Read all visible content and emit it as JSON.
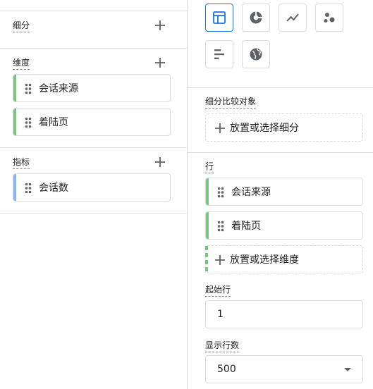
{
  "left": {
    "segments": {
      "label": "细分"
    },
    "dimensions": {
      "label": "维度",
      "items": [
        {
          "label": "会话来源"
        },
        {
          "label": "着陆页"
        }
      ]
    },
    "metrics": {
      "label": "指标",
      "items": [
        {
          "label": "会话数"
        }
      ]
    }
  },
  "right": {
    "visualizations": [
      {
        "icon": "table-icon",
        "selected": true
      },
      {
        "icon": "donut-chart-icon",
        "selected": false
      },
      {
        "icon": "line-chart-icon",
        "selected": false
      },
      {
        "icon": "scatter-chart-icon",
        "selected": false
      },
      {
        "icon": "bar-chart-icon",
        "selected": false
      },
      {
        "icon": "globe-icon",
        "selected": false
      }
    ],
    "segment_comparisons": {
      "label": "细分比较对象",
      "dropzone_label": "放置或选择细分"
    },
    "rows": {
      "label": "行",
      "items": [
        {
          "label": "会话来源"
        },
        {
          "label": "着陆页"
        }
      ],
      "dropzone_label": "放置或选择维度"
    },
    "start_row": {
      "label": "起始行",
      "value": "1"
    },
    "show_rows": {
      "label": "显示行数",
      "value": "500"
    }
  },
  "colors": {
    "dimension": "#7cc47f",
    "metric": "#8ab4f8",
    "selected": "#1a73e8"
  }
}
